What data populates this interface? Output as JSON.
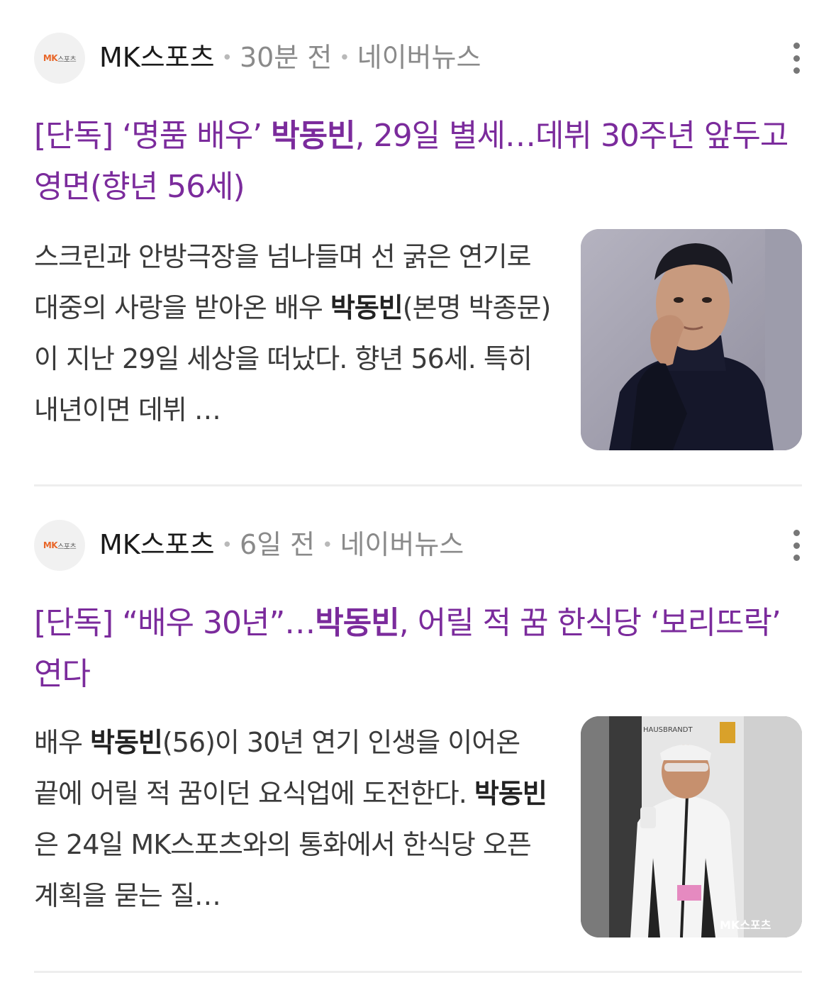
{
  "articles": [
    {
      "source": "MK스포츠",
      "logo_text_a": "MK",
      "logo_text_b": "스포츠",
      "time": "30분 전",
      "platform": "네이버뉴스",
      "headline_pre": "[단독] ‘명품 배우’ ",
      "headline_bold": "박동빈",
      "headline_post": ", 29일 별세…데뷔 30주년 앞두고 영면(향년 56세)",
      "summary_p1": "스크린과 안방극장을 넘나들며 선 굵은 연기로 대중의 사랑을 받아온 배우 ",
      "summary_b1": "박동빈",
      "summary_p2": "(본명 박종문)이 지난 29일 세상을 떠났다. 향년 56세. 특히 내년이면 데뷔 …",
      "thumbnail": "portrait-man-black-turtleneck"
    },
    {
      "source": "MK스포츠",
      "logo_text_a": "MK",
      "logo_text_b": "스포츠",
      "time": "6일 전",
      "platform": "네이버뉴스",
      "headline_pre": "[단독] “배우 30년”…",
      "headline_bold": "박동빈",
      "headline_post": ", 어릴 적 꿈 한식당 ‘보리뜨락’ 연다",
      "summary_p1": "배우 ",
      "summary_b1": "박동빈",
      "summary_p2": "(56)이 30년 연기 인생을 이어온 끝에 어릴 적 꿈이던 요식업에 도전한다. ",
      "summary_b2": "박동빈",
      "summary_p3": "은 24일 MK스포츠와의 통화에서 한식당 오픈 계획을 묻는 질…",
      "thumbnail": "man-white-jacket-sunglasses-event",
      "photo_text_brand": "HAUSBRANDT",
      "photo_text_watermark": "MK스포츠"
    }
  ],
  "colors": {
    "headline": "#7b2b9c",
    "logo_accent": "#e8672a",
    "meta": "#8a8a8a"
  }
}
